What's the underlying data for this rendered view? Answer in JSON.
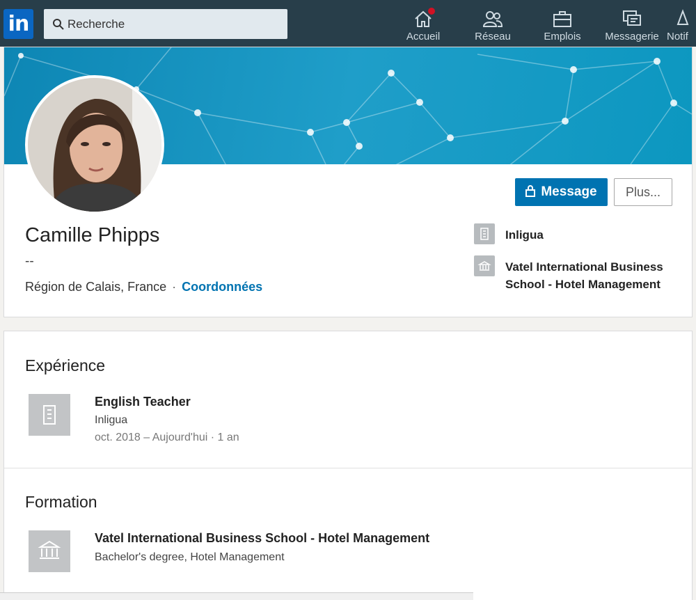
{
  "nav": {
    "logo_text": "in",
    "search_placeholder": "Recherche",
    "items": [
      {
        "label": "Accueil",
        "icon": "home-icon"
      },
      {
        "label": "Réseau",
        "icon": "network-icon"
      },
      {
        "label": "Emplois",
        "icon": "briefcase-icon"
      },
      {
        "label": "Messagerie",
        "icon": "messaging-icon"
      },
      {
        "label": "Notif",
        "icon": "bell-icon"
      }
    ],
    "bg_color": "#283e4a",
    "badge_color": "#d11124"
  },
  "profile": {
    "name": "Camille Phipps",
    "headline": "--",
    "location": "Région de Calais, France",
    "separator": "·",
    "contact_link": "Coordonnées",
    "message_button": "Message",
    "more_button": "Plus...",
    "current_company": "Inligua",
    "education": "Vatel International Business School - Hotel Management",
    "accent_color": "#0073b1"
  },
  "experience": {
    "title": "Expérience",
    "items": [
      {
        "role": "English Teacher",
        "company": "Inligua",
        "dates": "oct. 2018 – Aujourd'hui · 1 an"
      }
    ]
  },
  "education_section": {
    "title": "Formation",
    "items": [
      {
        "school": "Vatel International Business School - Hotel Management",
        "degree": "Bachelor's degree, Hotel Management"
      }
    ]
  }
}
